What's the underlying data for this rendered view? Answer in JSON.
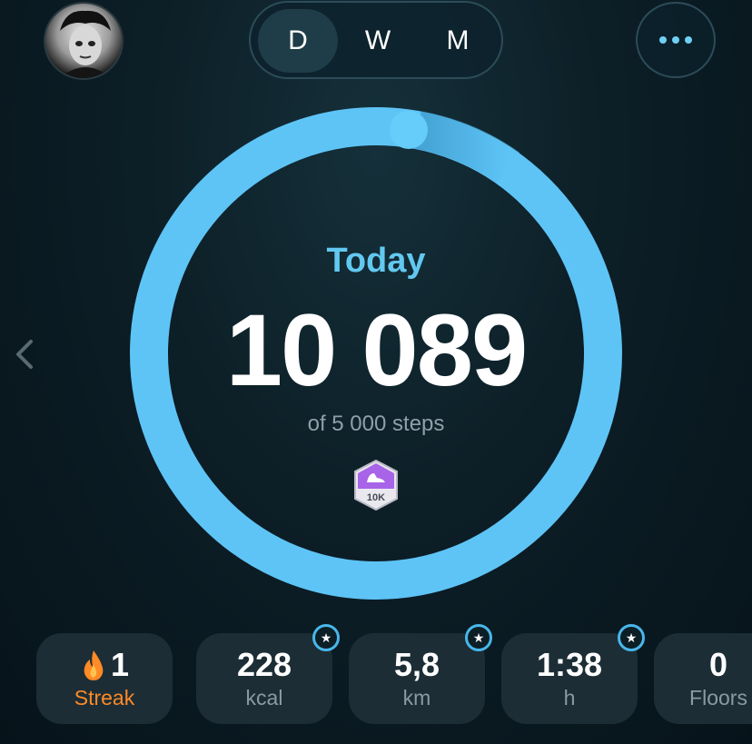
{
  "header": {
    "avatar_icon": "user-avatar",
    "periods": [
      "D",
      "W",
      "M"
    ],
    "selected_period": "D",
    "more_icon": "more-dots-icon"
  },
  "main": {
    "period_label": "Today",
    "steps_value": "10 089",
    "goal_text": "of 5 000 steps",
    "progress_fraction": 1.0,
    "badge_label": "10K",
    "colors": {
      "ring": "#5ec4f6",
      "ring_dark": "#3b9fd6",
      "today": "#62c8f0",
      "badge": "#a864e8",
      "streak": "#ff8a26"
    }
  },
  "stats": [
    {
      "value": "1",
      "label": "Streak",
      "icon": "flame-icon"
    },
    {
      "value": "228",
      "label": "kcal",
      "starred": true
    },
    {
      "value": "5,8",
      "label": "km",
      "starred": true
    },
    {
      "value": "1:38",
      "label": "h",
      "starred": true
    },
    {
      "value": "0",
      "label": "Floors"
    }
  ]
}
